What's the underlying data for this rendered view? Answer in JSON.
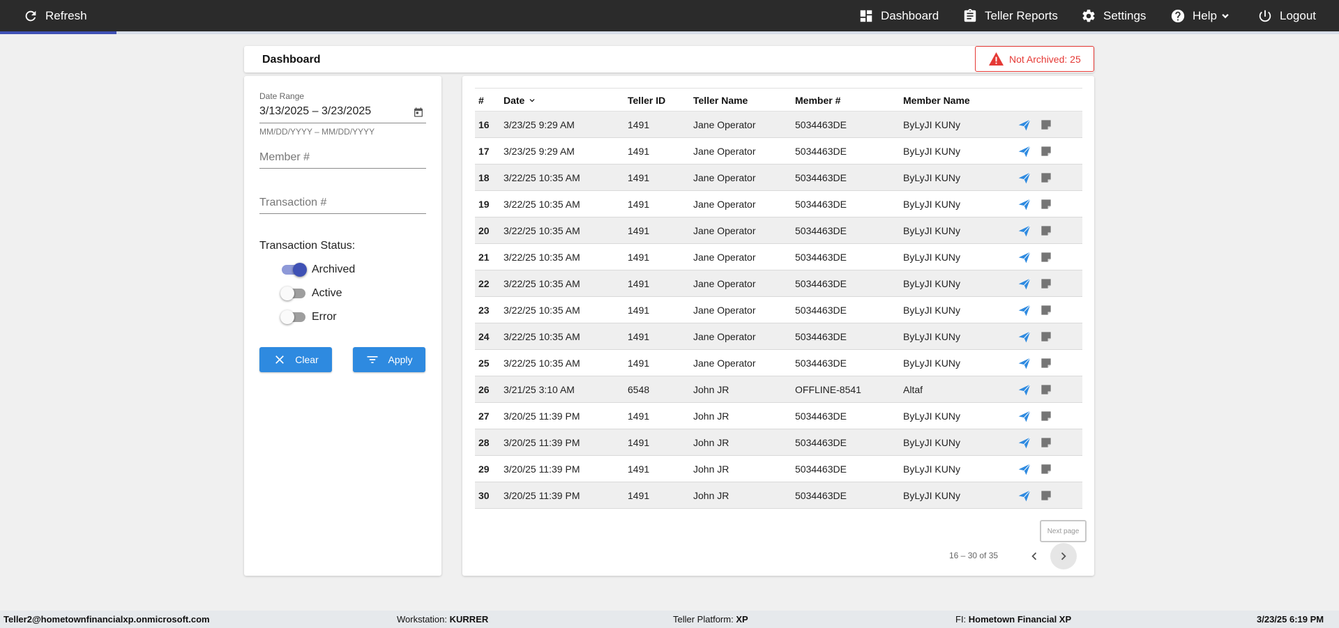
{
  "nav": {
    "refresh": "Refresh",
    "dashboard": "Dashboard",
    "teller_reports": "Teller Reports",
    "settings": "Settings",
    "help": "Help",
    "logout": "Logout",
    "load_progress": 0.087
  },
  "header": {
    "title": "Dashboard",
    "alert": "Not Archived: 25"
  },
  "filters": {
    "date_range_label": "Date Range",
    "date_range_value": "3/13/2025 – 3/23/2025",
    "date_range_hint": "MM/DD/YYYY – MM/DD/YYYY",
    "member_placeholder": "Member #",
    "transaction_placeholder": "Transaction #",
    "status_title": "Transaction Status:",
    "statuses": [
      {
        "label": "Archived",
        "on": true
      },
      {
        "label": "Active",
        "on": false
      },
      {
        "label": "Error",
        "on": false
      }
    ],
    "clear_label": "Clear",
    "apply_label": "Apply"
  },
  "table": {
    "columns": [
      "#",
      "Date",
      "Teller ID",
      "Teller Name",
      "Member #",
      "Member Name"
    ],
    "rows": [
      [
        "16",
        "3/23/25 9:29 AM",
        "1491",
        "Jane Operator",
        "5034463DE",
        "ByLyJI KUNy"
      ],
      [
        "17",
        "3/23/25 9:29 AM",
        "1491",
        "Jane Operator",
        "5034463DE",
        "ByLyJI KUNy"
      ],
      [
        "18",
        "3/22/25 10:35 AM",
        "1491",
        "Jane Operator",
        "5034463DE",
        "ByLyJI KUNy"
      ],
      [
        "19",
        "3/22/25 10:35 AM",
        "1491",
        "Jane Operator",
        "5034463DE",
        "ByLyJI KUNy"
      ],
      [
        "20",
        "3/22/25 10:35 AM",
        "1491",
        "Jane Operator",
        "5034463DE",
        "ByLyJI KUNy"
      ],
      [
        "21",
        "3/22/25 10:35 AM",
        "1491",
        "Jane Operator",
        "5034463DE",
        "ByLyJI KUNy"
      ],
      [
        "22",
        "3/22/25 10:35 AM",
        "1491",
        "Jane Operator",
        "5034463DE",
        "ByLyJI KUNy"
      ],
      [
        "23",
        "3/22/25 10:35 AM",
        "1491",
        "Jane Operator",
        "5034463DE",
        "ByLyJI KUNy"
      ],
      [
        "24",
        "3/22/25 10:35 AM",
        "1491",
        "Jane Operator",
        "5034463DE",
        "ByLyJI KUNy"
      ],
      [
        "25",
        "3/22/25 10:35 AM",
        "1491",
        "Jane Operator",
        "5034463DE",
        "ByLyJI KUNy"
      ],
      [
        "26",
        "3/21/25 3:10 AM",
        "6548",
        "John JR",
        "OFFLINE-8541",
        "Altaf"
      ],
      [
        "27",
        "3/20/25 11:39 PM",
        "1491",
        "John JR",
        "5034463DE",
        "ByLyJI KUNy"
      ],
      [
        "28",
        "3/20/25 11:39 PM",
        "1491",
        "John JR",
        "5034463DE",
        "ByLyJI KUNy"
      ],
      [
        "29",
        "3/20/25 11:39 PM",
        "1491",
        "John JR",
        "5034463DE",
        "ByLyJI KUNy"
      ],
      [
        "30",
        "3/20/25 11:39 PM",
        "1491",
        "John JR",
        "5034463DE",
        "ByLyJI KUNy"
      ]
    ],
    "row_actions": [
      "send-icon",
      "note-icon"
    ],
    "tooltip": "Next page",
    "range": "16 – 30 of 35"
  },
  "footer": {
    "user": "Teller2@hometownfinancialxp.onmicrosoft.com",
    "workstation_label": "Workstation:",
    "workstation_value": "KURRER",
    "platform_label": "Teller Platform:",
    "platform_value": "XP",
    "fi_label": "FI:",
    "fi_value": "Hometown Financial XP",
    "datetime": "3/23/25 6:19 PM"
  },
  "colors": {
    "topbar": "#2b2b2b",
    "accent": "#2e8ae0",
    "toggle_on": "#3f51b5",
    "alert": "#e53935"
  }
}
